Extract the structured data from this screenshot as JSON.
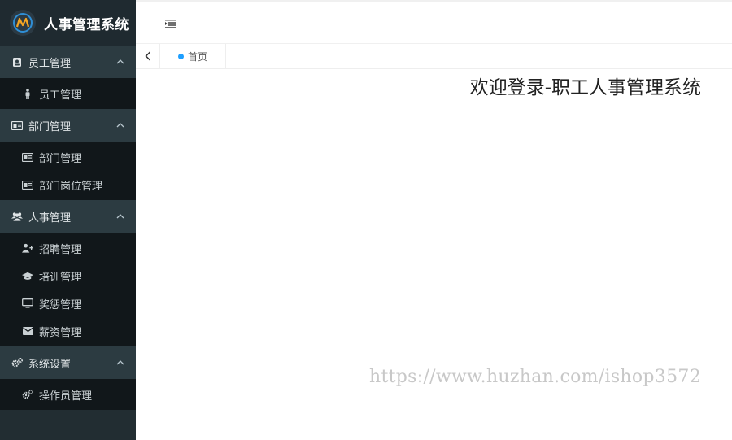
{
  "app": {
    "title": "人事管理系统"
  },
  "sidebar": {
    "groups": [
      {
        "label": "员工管理",
        "icon": "id-badge-icon",
        "items": [
          {
            "label": "员工管理",
            "icon": "person-icon"
          }
        ]
      },
      {
        "label": "部门管理",
        "icon": "id-card-icon",
        "items": [
          {
            "label": "部门管理",
            "icon": "id-card-icon"
          },
          {
            "label": "部门岗位管理",
            "icon": "id-card-icon"
          }
        ]
      },
      {
        "label": "人事管理",
        "icon": "users-icon",
        "items": [
          {
            "label": "招聘管理",
            "icon": "user-plus-icon"
          },
          {
            "label": "培训管理",
            "icon": "graduation-cap-icon"
          },
          {
            "label": "奖惩管理",
            "icon": "monitor-icon"
          },
          {
            "label": "薪资管理",
            "icon": "envelope-icon"
          }
        ]
      },
      {
        "label": "系统设置",
        "icon": "gears-icon",
        "items": [
          {
            "label": "操作员管理",
            "icon": "gears-icon"
          }
        ]
      }
    ]
  },
  "tabs": {
    "home_label": "首页"
  },
  "main": {
    "welcome": "欢迎登录-职工人事管理系统"
  },
  "watermark": "https://www.huzhan.com/ishop3572",
  "colors": {
    "sidebar": "#222d32",
    "group_header": "#2c3b41",
    "submenu": "#11171a",
    "accent": "#1e9fff"
  }
}
